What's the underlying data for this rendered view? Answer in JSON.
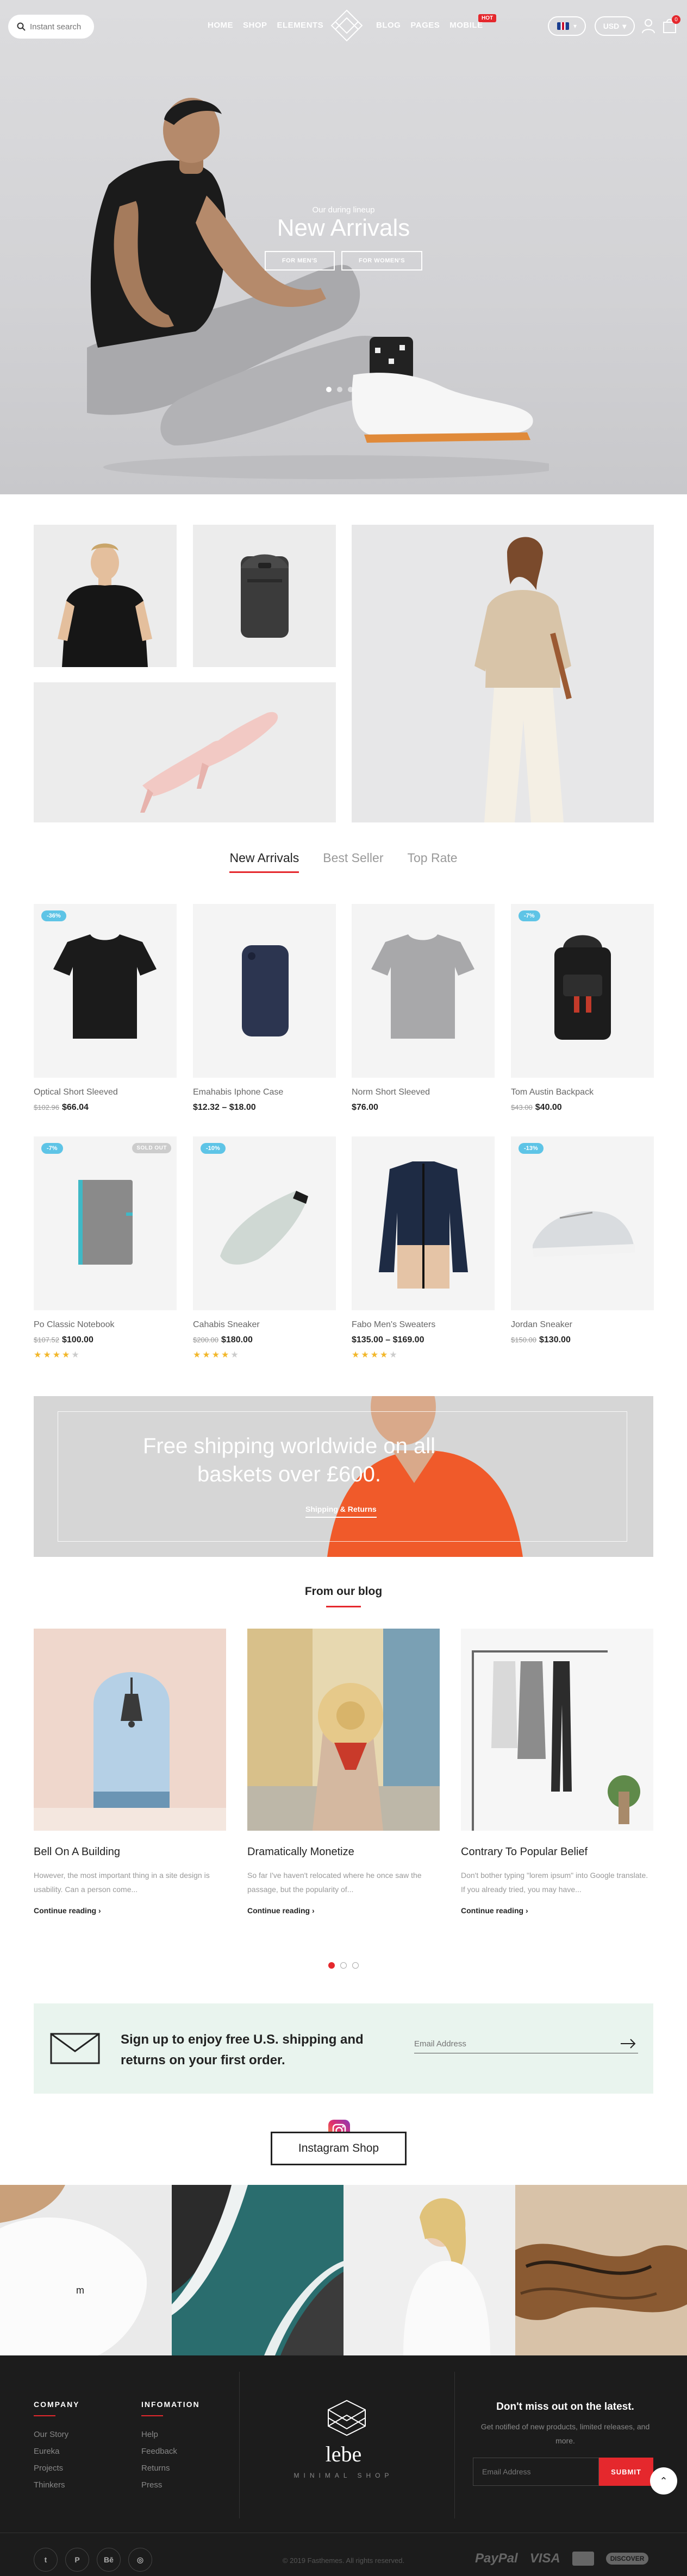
{
  "nav": {
    "search_placeholder": "Instant search",
    "menu_left": [
      "HOME",
      "SHOP",
      "ELEMENTS"
    ],
    "menu_right": [
      "BLOG",
      "PAGES",
      "MOBILE"
    ],
    "hot_badge": "HOT",
    "currency": "USD",
    "cart_count": "0"
  },
  "hero": {
    "subtitle": "Our during lineup",
    "title": "New Arrivals",
    "buttons": [
      "FOR MEN'S",
      "FOR WOMEN'S"
    ]
  },
  "tabs": [
    "New Arrivals",
    "Best Seller",
    "Top Rate"
  ],
  "products": [
    {
      "name": "Optical Short Sleeved",
      "old_price": "$102.96",
      "price": "$66.04",
      "badge": "-36%",
      "sold": "",
      "rating": 0
    },
    {
      "name": "Emahabis Iphone Case",
      "old_price": "",
      "price": "$12.32 – $18.00",
      "badge": "",
      "sold": "",
      "rating": 0
    },
    {
      "name": "Norm Short Sleeved",
      "old_price": "",
      "price": "$76.00",
      "badge": "",
      "sold": "",
      "rating": 0
    },
    {
      "name": "Tom Austin Backpack",
      "old_price": "$43.00",
      "price": "$40.00",
      "badge": "-7%",
      "sold": "",
      "rating": 0
    },
    {
      "name": "Po Classic Notebook",
      "old_price": "$107.52",
      "price": "$100.00",
      "badge": "-7%",
      "sold": "SOLD OUT",
      "rating": 4
    },
    {
      "name": "Cahabis Sneaker",
      "old_price": "$200.00",
      "price": "$180.00",
      "badge": "-10%",
      "sold": "",
      "rating": 4
    },
    {
      "name": "Fabo Men's Sweaters",
      "old_price": "",
      "price": "$135.00 – $169.00",
      "badge": "",
      "sold": "",
      "rating": 4
    },
    {
      "name": "Jordan Sneaker",
      "old_price": "$150.00",
      "price": "$130.00",
      "badge": "-13%",
      "sold": "",
      "rating": 0
    }
  ],
  "banner": {
    "text": "Free shipping worldwide on all baskets over £600.",
    "link": "Shipping & Returns"
  },
  "blog": {
    "title": "From our blog",
    "posts": [
      {
        "title": "Bell On A Building",
        "excerpt": "However, the most important thing in a site design is usability. Can a person come...",
        "more": "Continue reading"
      },
      {
        "title": "Dramatically Monetize",
        "excerpt": "So far I've haven't relocated where he once saw the passage, but the popularity of...",
        "more": "Continue reading"
      },
      {
        "title": "Contrary To Popular Belief",
        "excerpt": "Don't bother typing \"lorem ipsum\" into Google translate. If you already tried, you may have...",
        "more": "Continue reading"
      }
    ]
  },
  "newsletter": {
    "text": "Sign up to enjoy free U.S. shipping and returns on your first order.",
    "placeholder": "Email Address"
  },
  "instagram": {
    "button": "Instagram Shop"
  },
  "footer": {
    "col1": {
      "head": "COMPANY",
      "items": [
        "Our Story",
        "Eureka",
        "Projects",
        "Thinkers"
      ]
    },
    "col2": {
      "head": "INFOMATION",
      "items": [
        "Help",
        "Feedback",
        "Returns",
        "Press"
      ]
    },
    "brand": "lebe",
    "tagline": "MINIMAL SHOP",
    "news_head": "Don't miss out on the latest.",
    "news_sub": "Get notified of new products, limited releases, and more.",
    "email_placeholder": "Email Address",
    "submit": "SUBMIT",
    "copyright": "© 2019 Fasthemes. All rights reserved.",
    "payments": [
      "PayPal",
      "VISA",
      "DISCOVER"
    ]
  },
  "colors": {
    "accent": "#e5282d",
    "badge": "#5ec4e6",
    "newsletter_bg": "#e9f4ee",
    "footer_bg": "#1c1c1c"
  }
}
